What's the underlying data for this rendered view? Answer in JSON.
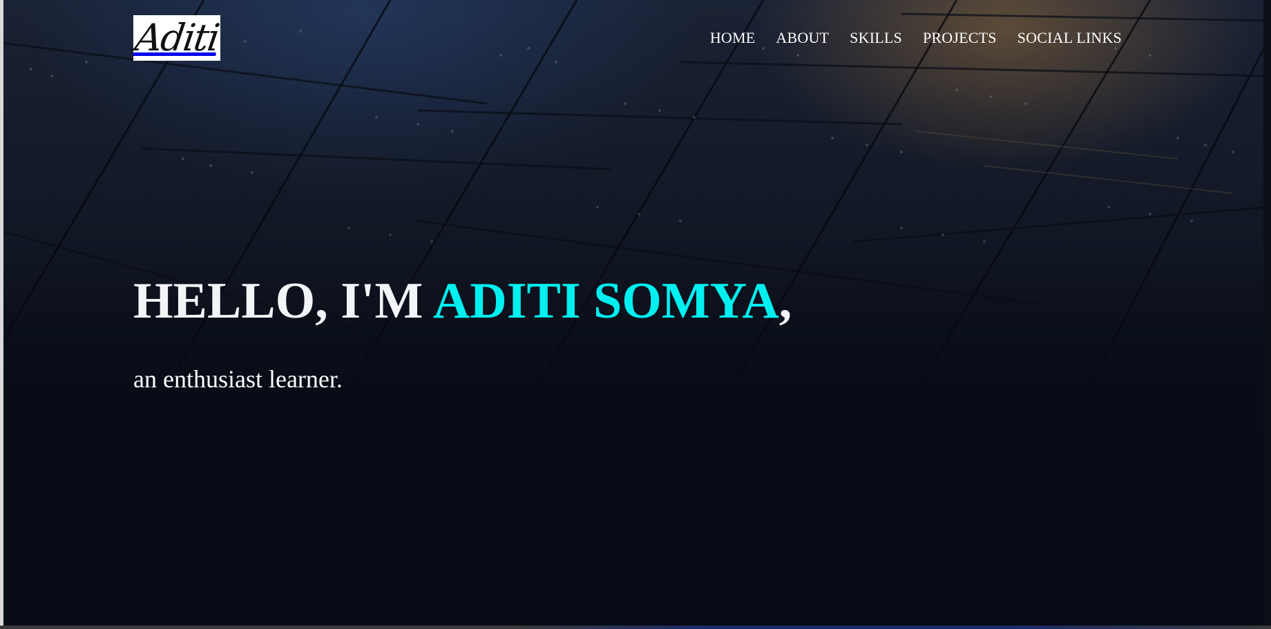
{
  "logo": {
    "text": "Aditi"
  },
  "nav": {
    "items": [
      {
        "label": "HOME"
      },
      {
        "label": "ABOUT"
      },
      {
        "label": "SKILLS"
      },
      {
        "label": "PROJECTS"
      },
      {
        "label": "SOCIAL LINKS"
      }
    ]
  },
  "hero": {
    "greeting": "HELLO, I'M ",
    "name": "ADITI SOMYA",
    "punctuation": ",",
    "subtitle": "an enthusiast learner."
  },
  "colors": {
    "accent": "#00f0f0",
    "text": "#ffffff",
    "background": "#070b15"
  }
}
